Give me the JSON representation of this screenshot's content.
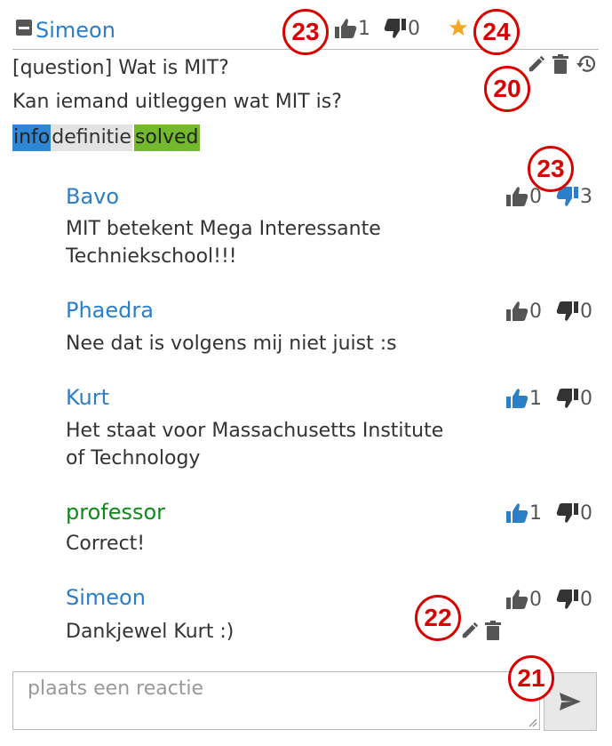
{
  "post": {
    "author": "Simeon",
    "likes": "1",
    "dislikes": "0",
    "title": "[question] Wat is MIT?",
    "body": "Kan iemand uitleggen wat MIT is?",
    "tags": [
      {
        "label": "info",
        "color": "#2f86d4"
      },
      {
        "label": "definitie",
        "color": "#e3e3e3"
      },
      {
        "label": "solved",
        "color": "#73b82d"
      }
    ]
  },
  "replies": [
    {
      "author": "Bavo",
      "text_line1": "MIT betekent Mega Interessante",
      "text_line2": "Techniekschool!!!",
      "likes": "0",
      "dislikes": "3"
    },
    {
      "author": "Phaedra",
      "text_line1": "Nee dat is volgens mij niet juist :s",
      "likes": "0",
      "dislikes": "0"
    },
    {
      "author": "Kurt",
      "text_line1": "Het staat voor Massachusetts Institute",
      "text_line2": "of Technology",
      "likes": "1",
      "dislikes": "0"
    },
    {
      "author": "professor",
      "text_line1": "Correct!",
      "likes": "1",
      "dislikes": "0"
    },
    {
      "author": "Simeon",
      "text_line1": "Dankjewel Kurt :)",
      "likes": "0",
      "dislikes": "0"
    }
  ],
  "comment_box": {
    "placeholder": "plaats een reactie"
  },
  "annotations": {
    "a23_top": "23",
    "a24": "24",
    "a20": "20",
    "a23_reply": "23",
    "a22": "22",
    "a21": "21"
  },
  "colors": {
    "link": "#2b7ec8",
    "professor": "#0e8a1a",
    "star": "#f5a623",
    "annotation": "#d90000"
  }
}
